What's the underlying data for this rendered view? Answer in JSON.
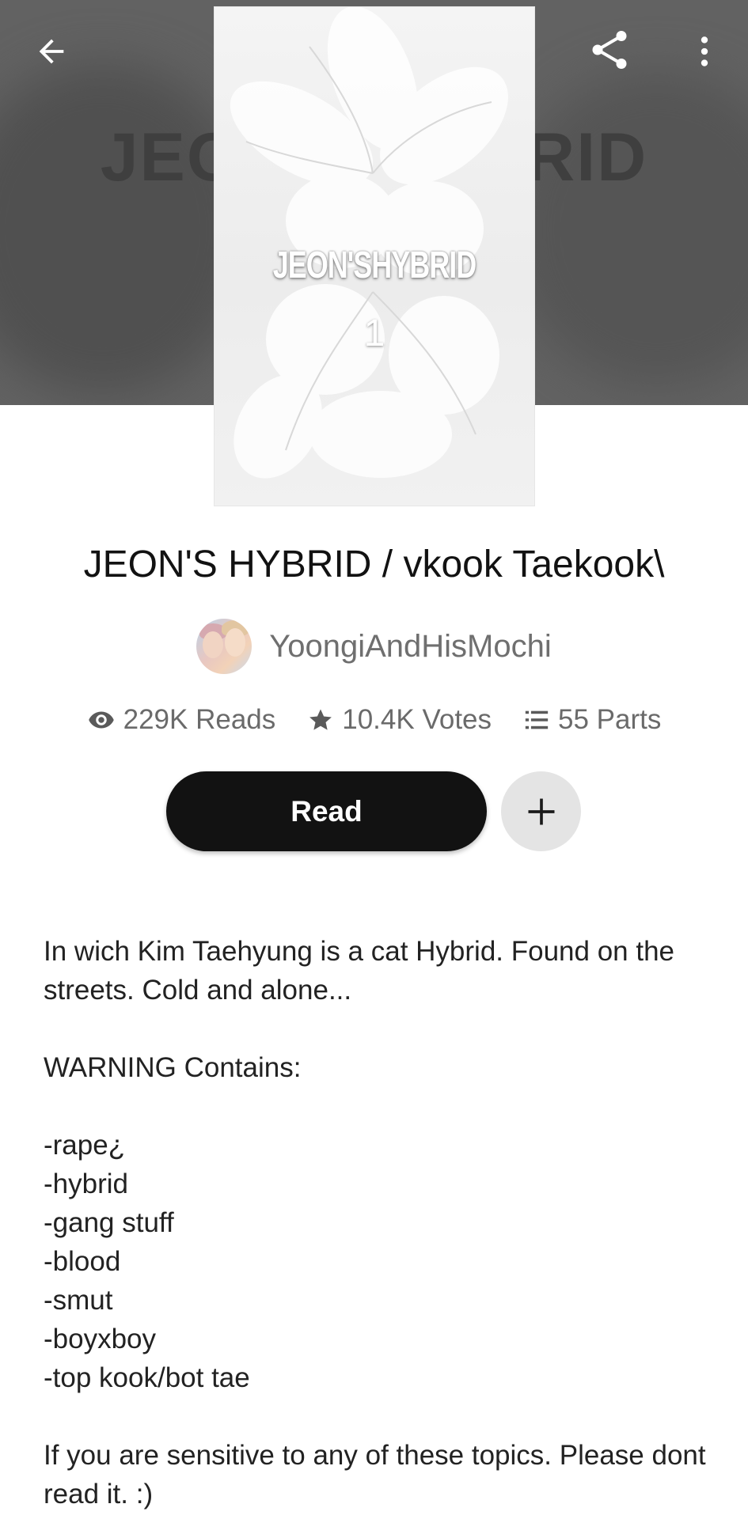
{
  "header": {
    "background_text": "JEON'S HYBRID",
    "back_icon": "arrow-left-icon",
    "share_icon": "share-icon",
    "more_icon": "more-vertical-icon"
  },
  "cover": {
    "title": "JEON'SHYBRID",
    "number": "1"
  },
  "story": {
    "title": "JEON'S HYBRID / vkook Taekook\\",
    "author": "YoongiAndHisMochi",
    "reads": "229K Reads",
    "votes": "10.4K Votes",
    "parts": "55 Parts"
  },
  "actions": {
    "read_label": "Read",
    "add_icon": "plus-icon"
  },
  "description": {
    "intro_1": "In wich Kim Taehyung is a cat Hybrid. Found on the",
    "intro_2": "streets. Cold and alone...",
    "warning": "WARNING Contains:",
    "items": [
      "-rape¿",
      "-hybrid",
      "-gang stuff",
      "-blood",
      "-smut",
      "-boyxboy",
      "-top kook/bot tae"
    ],
    "closing_1": "If you are sensitive to any of these topics. Please dont",
    "closing_2": "read it.  :)"
  },
  "colors": {
    "header_bg": "#626262",
    "read_button": "#121212",
    "add_button": "#e4e4e4",
    "text_muted": "#6a6a6a"
  }
}
